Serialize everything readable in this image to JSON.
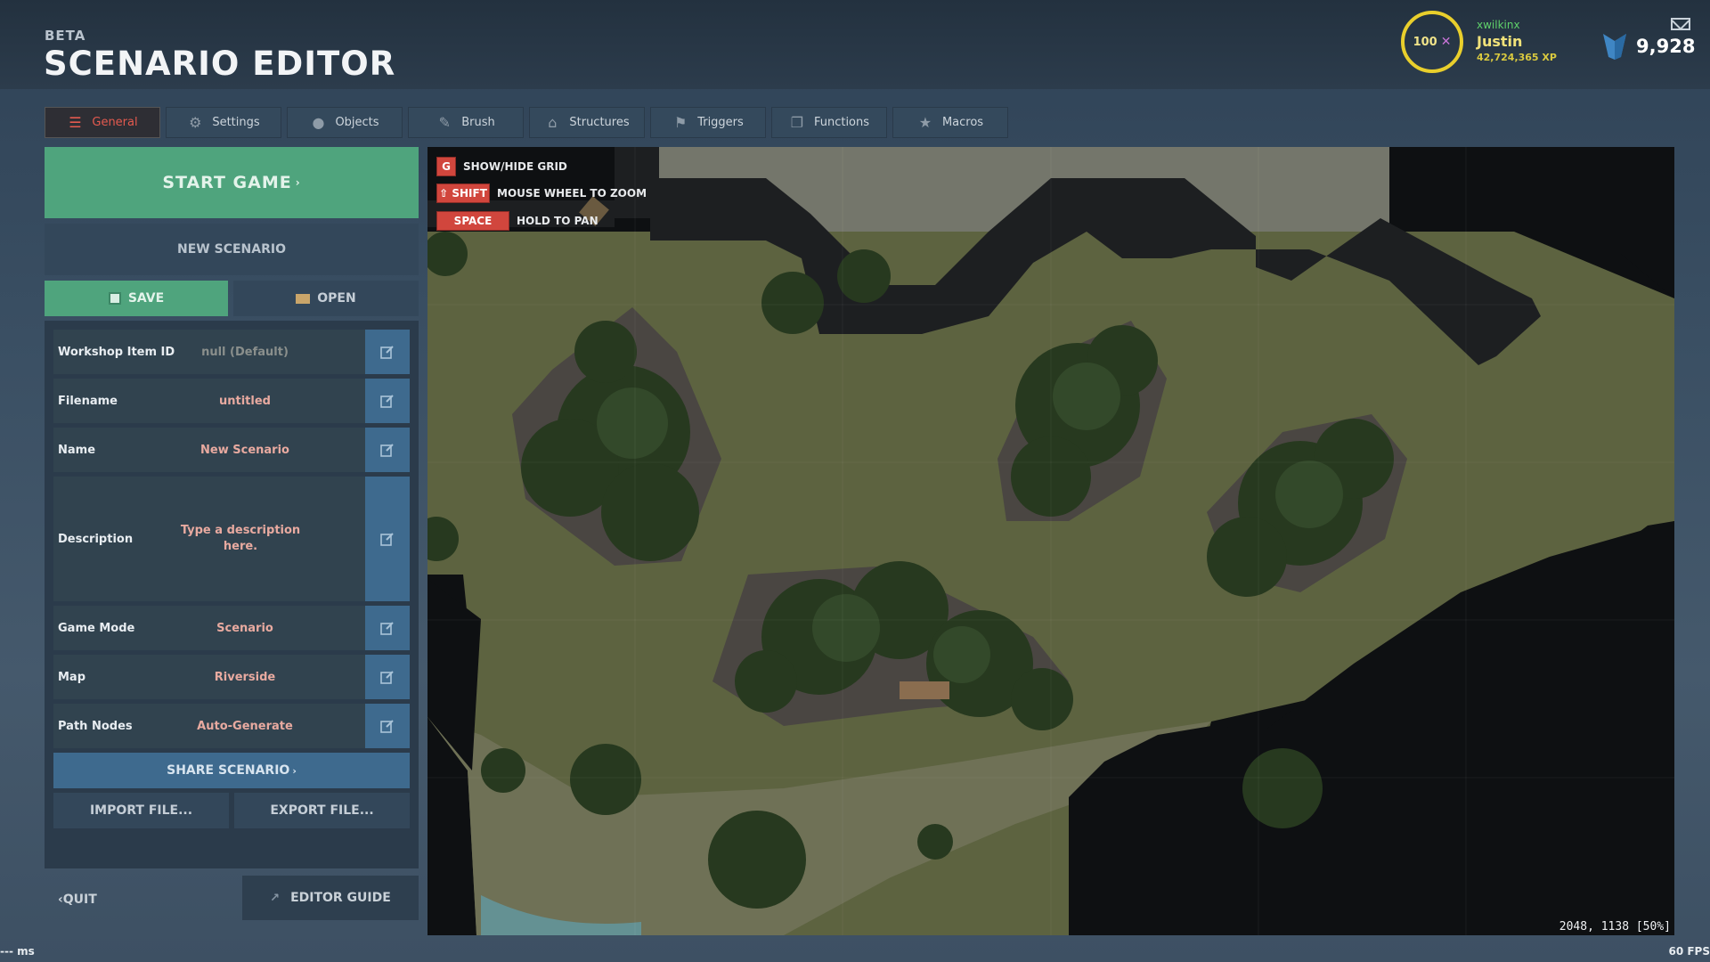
{
  "header": {
    "beta": "BETA",
    "title": "SCENARIO EDITOR"
  },
  "player": {
    "level": "100",
    "level_icon": "x-icon",
    "clan": "xwilkinx",
    "name": "Justin",
    "xp": "42,724,365 XP",
    "currency": "9,928",
    "currency_icon": "gem-icon",
    "colors": {
      "level_ring": "#e9cf2c",
      "clan": "#5fd16a",
      "name": "#f1e27a"
    }
  },
  "tabs": [
    {
      "label": "General",
      "icon": "menu-icon",
      "active": true
    },
    {
      "label": "Settings",
      "icon": "gear-icon"
    },
    {
      "label": "Objects",
      "icon": "object-icon"
    },
    {
      "label": "Brush",
      "icon": "brush-icon"
    },
    {
      "label": "Structures",
      "icon": "house-icon"
    },
    {
      "label": "Triggers",
      "icon": "flag-icon"
    },
    {
      "label": "Functions",
      "icon": "copy-icon"
    },
    {
      "label": "Macros",
      "icon": "star-icon"
    }
  ],
  "panel": {
    "start_game": "START GAME",
    "new_scenario": "NEW SCENARIO",
    "save": "SAVE",
    "open": "OPEN",
    "share": "SHARE SCENARIO",
    "import": "IMPORT FILE...",
    "export": "EXPORT FILE...",
    "quit": "QUIT",
    "editor_guide": "EDITOR GUIDE"
  },
  "properties": [
    {
      "label": "Workshop Item ID",
      "value": "null (Default)"
    },
    {
      "label": "Filename",
      "value": "untitled"
    },
    {
      "label": "Name",
      "value": "New Scenario"
    },
    {
      "label": "Description",
      "value": "Type a description here."
    },
    {
      "label": "Game Mode",
      "value": "Scenario"
    },
    {
      "label": "Map",
      "value": "Riverside"
    },
    {
      "label": "Path Nodes",
      "value": "Auto-Generate"
    }
  ],
  "map": {
    "hints": [
      {
        "key": "G",
        "text": "SHOW/HIDE GRID"
      },
      {
        "key": "⇧ SHIFT",
        "text": "MOUSE WHEEL TO ZOOM"
      },
      {
        "key": "SPACE",
        "text": "HOLD TO PAN"
      }
    ],
    "coords": "2048, 1138 [50%]"
  },
  "status": {
    "ping": "--- ms",
    "fps": "60 FPS"
  },
  "colors": {
    "accent_green": "#4fa47d",
    "accent_red": "#d1463d",
    "accent_blue": "#3e6a8e"
  }
}
